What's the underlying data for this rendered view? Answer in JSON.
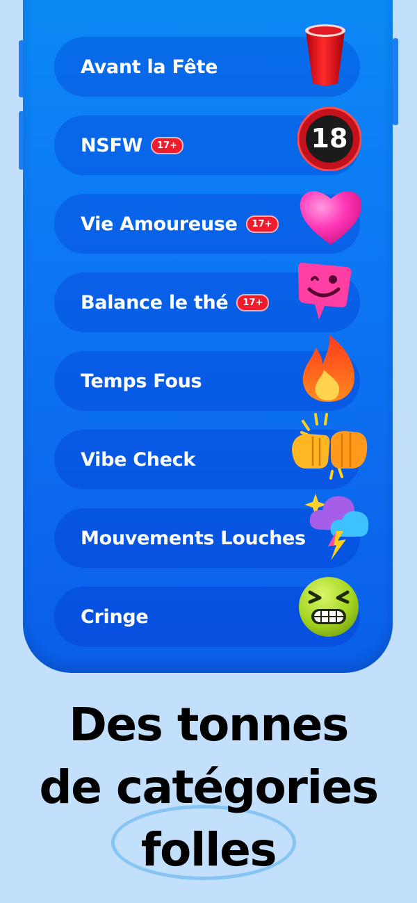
{
  "categories": [
    {
      "label": "Avant la Fête",
      "badge": "",
      "icon": "red-cup-icon"
    },
    {
      "label": "NSFW",
      "badge": "17+",
      "icon": "eighteen-sign-icon"
    },
    {
      "label": "Vie Amoureuse",
      "badge": "17+",
      "icon": "pink-heart-icon"
    },
    {
      "label": "Balance le thé",
      "badge": "17+",
      "icon": "winking-speech-bubble-icon"
    },
    {
      "label": "Temps Fous",
      "badge": "",
      "icon": "fire-icon"
    },
    {
      "label": "Vibe Check",
      "badge": "",
      "icon": "fist-bump-icon"
    },
    {
      "label": "Mouvements Louches",
      "badge": "",
      "icon": "storm-cloud-icon"
    },
    {
      "label": "Cringe",
      "badge": "",
      "icon": "grimacing-face-icon"
    }
  ],
  "eighteen_sign_text": "18",
  "headline": {
    "line1": "Des tonnes",
    "line2": "de catégories",
    "line3": "folles"
  },
  "colors": {
    "background": "#c2e0fb",
    "phone_blue": "#0d76f3",
    "badge_red": "#ee1c2d"
  }
}
